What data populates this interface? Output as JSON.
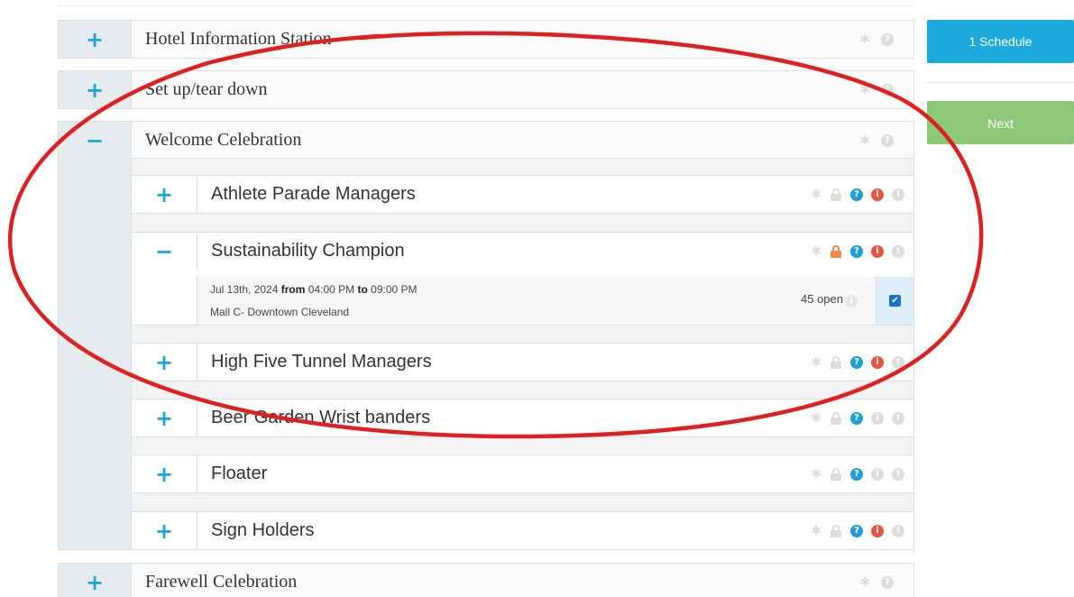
{
  "groups": {
    "hotel": {
      "toggle": "+",
      "title": "Hotel Information Station"
    },
    "setup": {
      "toggle": "+",
      "title": "Set up/tear down"
    },
    "welcome": {
      "toggle": "−",
      "title": "Welcome Celebration",
      "shifts": [
        {
          "toggle": "+",
          "title": "Athlete Parade Managers"
        },
        {
          "toggle": "−",
          "title": "Sustainability Champion",
          "detail": {
            "date": "Jul 13th, 2024",
            "from_word": "from",
            "start": "04:00 PM",
            "to_word": "to",
            "end": "09:00 PM",
            "location": "Mall C- Downtown Cleveland",
            "open_count": "45 open"
          }
        },
        {
          "toggle": "+",
          "title": "High Five Tunnel Managers"
        },
        {
          "toggle": "+",
          "title": "Beer Garden Wrist banders"
        },
        {
          "toggle": "+",
          "title": "Floater"
        },
        {
          "toggle": "+",
          "title": "Sign Holders"
        }
      ]
    },
    "farewell": {
      "toggle": "+",
      "title": "Farewell Celebration"
    }
  },
  "sidebar": {
    "schedule_label": "1 Schedule",
    "next_label": "Next"
  },
  "colors": {
    "accent_blue": "#1caadc",
    "toggle_blue": "#1fa4d9",
    "next_green": "#8cc878",
    "help_blue": "#1e9ed6",
    "info_red": "#e65540",
    "lock_orange": "#f08a4b",
    "icon_grey": "#dddddd",
    "annotation_red": "#e02020"
  },
  "icons": {
    "gear": "gear-icon",
    "lock": "lock-icon",
    "help": "help-icon",
    "info": "info-icon",
    "check": "checkbox-checked-icon"
  }
}
